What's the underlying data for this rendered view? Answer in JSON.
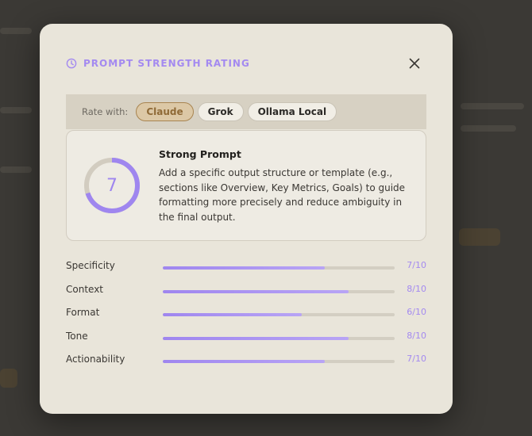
{
  "modal": {
    "title": "PROMPT STRENGTH RATING",
    "close_icon": "close-icon",
    "title_icon": "clock-icon"
  },
  "rate_with": {
    "label": "Rate with:",
    "options": [
      {
        "label": "Claude",
        "selected": true
      },
      {
        "label": "Grok",
        "selected": false
      },
      {
        "label": "Ollama Local",
        "selected": false
      }
    ]
  },
  "summary": {
    "score": "7",
    "score_fraction": 0.7,
    "title": "Strong Prompt",
    "text": "Add a specific output structure or template (e.g., sections like Overview, Key Metrics, Goals) to guide formatting more precisely and reduce ambiguity in the final output."
  },
  "metrics": [
    {
      "label": "Specificity",
      "value": "7/10",
      "score": 7
    },
    {
      "label": "Context",
      "value": "8/10",
      "score": 8
    },
    {
      "label": "Format",
      "value": "6/10",
      "score": 6
    },
    {
      "label": "Tone",
      "value": "8/10",
      "score": 8
    },
    {
      "label": "Actionability",
      "value": "7/10",
      "score": 7
    }
  ],
  "colors": {
    "accent": "#9f86ef",
    "selected_pill": "#dcc8a6",
    "modal_bg": "#e9e5da"
  }
}
